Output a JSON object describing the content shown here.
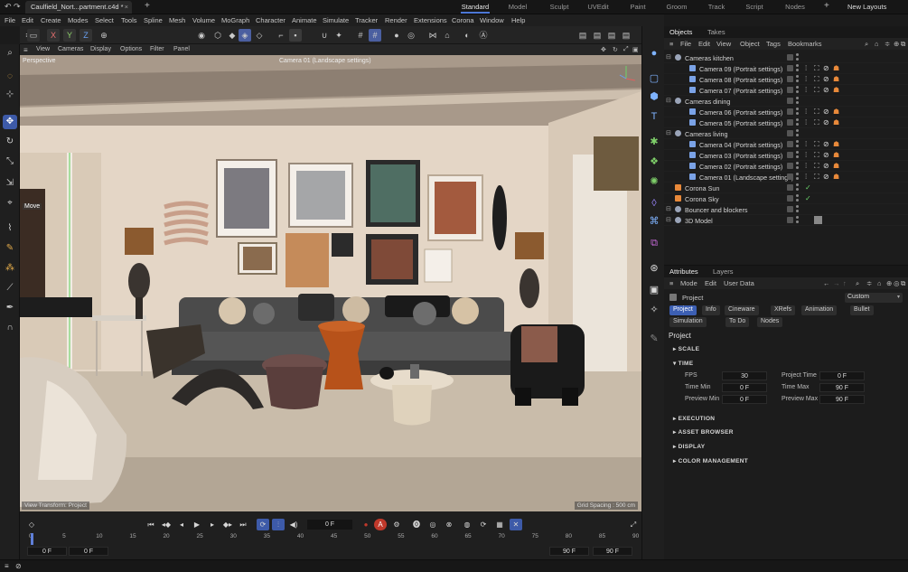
{
  "titlebar": {
    "doc_tab": "Caulfield_Nort...partment.c4d *",
    "layouts": [
      "Standard",
      "Model",
      "Sculpt",
      "UVEdit",
      "Paint",
      "Groom",
      "Track",
      "Script",
      "Nodes"
    ],
    "active_layout": "Standard",
    "new_layouts": "New Layouts"
  },
  "menubar": [
    "File",
    "Edit",
    "Create",
    "Modes",
    "Select",
    "Tools",
    "Spline",
    "Mesh",
    "Volume",
    "MoGraph",
    "Character",
    "Animate",
    "Simulate",
    "Tracker",
    "Render",
    "Extensions",
    "Corona",
    "Window",
    "Help"
  ],
  "toolbar": {
    "x": "X",
    "y": "Y",
    "z": "Z"
  },
  "viewport": {
    "menu": [
      "View",
      "Cameras",
      "Display",
      "Options",
      "Filter",
      "Panel"
    ],
    "view_name": "Perspective",
    "camera": "Camera 01 (Landscape settings)",
    "move_label": "Move",
    "view_transform": "View Transform: Project",
    "grid_spacing": "Grid Spacing : 500 cm"
  },
  "objects": {
    "tabs": [
      "Objects",
      "Takes"
    ],
    "menu": [
      "File",
      "Edit",
      "View",
      "Object",
      "Tags",
      "Bookmarks"
    ],
    "rows": [
      {
        "name": "Cameras kitchen",
        "level": 0,
        "kind": "null"
      },
      {
        "name": "Camera 09 (Portrait settings)",
        "level": 1,
        "kind": "camera"
      },
      {
        "name": "Camera 08 (Portrait settings)",
        "level": 1,
        "kind": "camera"
      },
      {
        "name": "Camera 07 (Portrait settings)",
        "level": 1,
        "kind": "camera"
      },
      {
        "name": "Cameras dining",
        "level": 0,
        "kind": "null"
      },
      {
        "name": "Camera 06 (Portrait settings)",
        "level": 1,
        "kind": "camera"
      },
      {
        "name": "Camera 05 (Portrait settings)",
        "level": 1,
        "kind": "camera"
      },
      {
        "name": "Cameras living",
        "level": 0,
        "kind": "null"
      },
      {
        "name": "Camera 04 (Portrait settings)",
        "level": 1,
        "kind": "camera"
      },
      {
        "name": "Camera 03 (Portrait settings)",
        "level": 1,
        "kind": "camera"
      },
      {
        "name": "Camera 02 (Portrait settings)",
        "level": 1,
        "kind": "camera"
      },
      {
        "name": "Camera 01 (Landscape settings)",
        "level": 1,
        "kind": "camera"
      },
      {
        "name": "Corona Sun",
        "level": 0,
        "kind": "sun"
      },
      {
        "name": "Corona Sky",
        "level": 0,
        "kind": "sky"
      },
      {
        "name": "Bouncer and blockers",
        "level": 0,
        "kind": "null"
      },
      {
        "name": "3D Model",
        "level": 0,
        "kind": "null"
      }
    ]
  },
  "attributes": {
    "tabs": [
      "Attributes",
      "Layers"
    ],
    "menu": [
      "Mode",
      "Edit",
      "User Data"
    ],
    "object": "Project",
    "preset": "Custom",
    "buttons": [
      "Project",
      "Info",
      "Cineware",
      "XRefs",
      "Animation",
      "Bullet",
      "Simulation",
      "To Do",
      "Nodes"
    ],
    "heading": "Project",
    "sections": [
      "SCALE",
      "TIME",
      "EXECUTION",
      "ASSET BROWSER",
      "DISPLAY",
      "COLOR MANAGEMENT"
    ],
    "fields": {
      "fps_label": "FPS",
      "fps": "30",
      "project_time_label": "Project Time",
      "project_time": "0 F",
      "time_min_label": "Time Min",
      "time_min": "0 F",
      "time_max_label": "Time Max",
      "time_max": "90 F",
      "preview_min_label": "Preview Min",
      "preview_min": "0 F",
      "preview_max_label": "Preview Max",
      "preview_max": "90 F"
    }
  },
  "timeline": {
    "current_frame": "0 F",
    "ticks": [
      "0",
      "5",
      "10",
      "15",
      "20",
      "25",
      "30",
      "35",
      "40",
      "45",
      "50",
      "55",
      "60",
      "65",
      "70",
      "75",
      "80",
      "85",
      "90"
    ],
    "start_a": "0 F",
    "start_b": "0 F",
    "end_a": "90 F",
    "end_b": "90 F"
  },
  "colors": {
    "accent": "#4c77d6",
    "selection": "#3d5aa8",
    "wall": "#e3d4c3",
    "floor": "#c9bcaa",
    "sofa": "#4a4a4a"
  }
}
